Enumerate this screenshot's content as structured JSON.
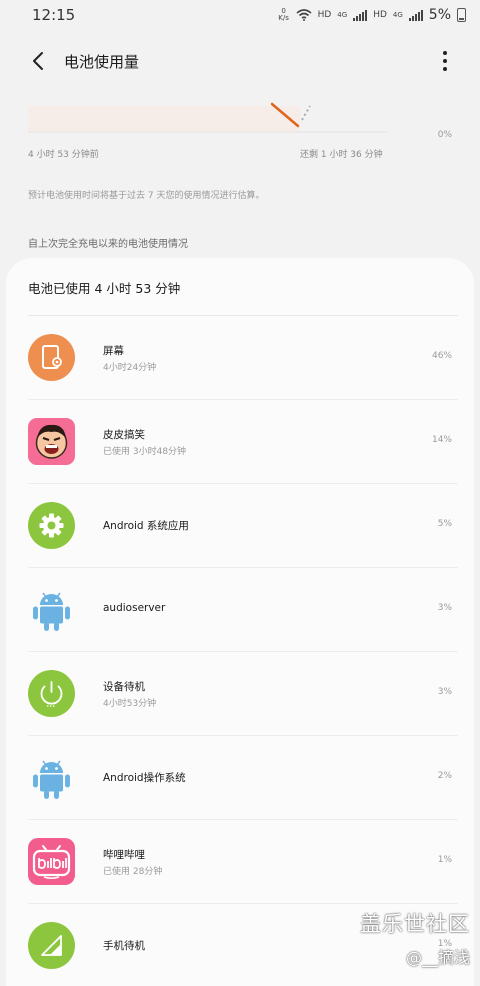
{
  "status_bar": {
    "time": "12:15",
    "net_speed": "0 K/s",
    "hd_1": "HD",
    "net_1": "4G",
    "hd_2": "HD",
    "net_2": "4G",
    "battery_percent": "5%"
  },
  "app_bar": {
    "title": "电池使用量"
  },
  "graph": {
    "percent_label": "0%",
    "left_label": "4 小时 53 分钟前",
    "right_label": "还剩 1 小时 36 分钟",
    "colors": {
      "used_line": "#e2631e",
      "predicted": "#aaaaaa"
    }
  },
  "note": "预计电池使用时间将基于过去 7 天您的使用情况进行估算。",
  "section_label": "自上次完全充电以来的电池使用情况",
  "usage_card": {
    "title": "电池已使用 4 小时 53 分钟",
    "apps": [
      {
        "name": "屏幕",
        "sub": "4小时24分钟",
        "percent": "46%",
        "icon": "screen-icon"
      },
      {
        "name": "皮皮搞笑",
        "sub": "已使用 3小时48分钟",
        "percent": "14%",
        "icon": "pipi-gaoxiao-app-icon"
      },
      {
        "name": "Android 系统应用",
        "sub": "",
        "percent": "5%",
        "icon": "android-settings-icon"
      },
      {
        "name": "audioserver",
        "sub": "",
        "percent": "3%",
        "icon": "android-robot-icon"
      },
      {
        "name": "设备待机",
        "sub": "4小时53分钟",
        "percent": "3%",
        "icon": "power-icon"
      },
      {
        "name": "Android操作系统",
        "sub": "",
        "percent": "2%",
        "icon": "android-robot-icon"
      },
      {
        "name": "哔哩哔哩",
        "sub": "已使用 28分钟",
        "percent": "1%",
        "icon": "bilibili-app-icon"
      },
      {
        "name": "手机待机",
        "sub": "",
        "percent": "1%",
        "icon": "signal-icon"
      }
    ]
  },
  "watermark": {
    "main": "盖乐世社区",
    "sub": "@__摘浅"
  }
}
